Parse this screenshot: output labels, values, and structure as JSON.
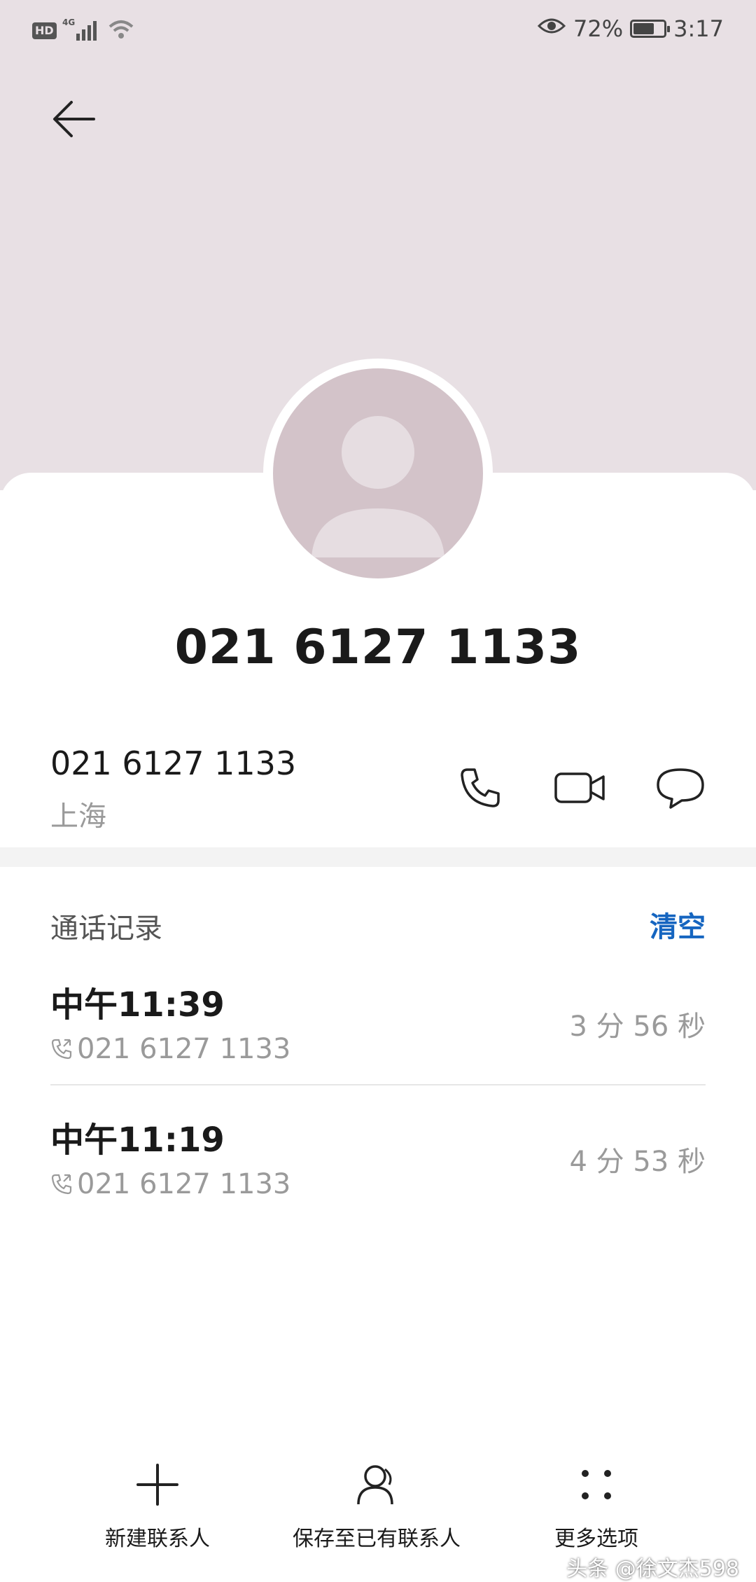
{
  "status_bar": {
    "left_badge": "HD",
    "network": "4G",
    "battery_percent": "72%",
    "battery_level": 0.72,
    "time": "3:17"
  },
  "contact": {
    "title_number": "021 6127 1133",
    "number": "021 6127 1133",
    "location": "上海"
  },
  "call_log": {
    "title": "通话记录",
    "clear_label": "清空",
    "items": [
      {
        "time": "中午11:39",
        "number": "021 6127 1133",
        "duration": "3 分 56 秒"
      },
      {
        "time": "中午11:19",
        "number": "021 6127 1133",
        "duration": "4 分 53 秒"
      }
    ]
  },
  "bottom_actions": {
    "new_contact": "新建联系人",
    "save_existing": "保存至已有联系人",
    "more_options": "更多选项"
  },
  "watermark": "头条 @徐文杰598",
  "colors": {
    "header_bg": "#e8e0e4",
    "avatar_bg": "#d3c3c9",
    "accent": "#1565c0",
    "secondary_text": "#9a9a9a"
  },
  "icons": [
    "back-arrow-icon",
    "eye-icon",
    "wifi-icon",
    "signal-icon",
    "battery-icon",
    "phone-icon",
    "video-call-icon",
    "message-icon",
    "incoming-call-icon",
    "plus-icon",
    "person-icon",
    "more-dots-icon"
  ]
}
